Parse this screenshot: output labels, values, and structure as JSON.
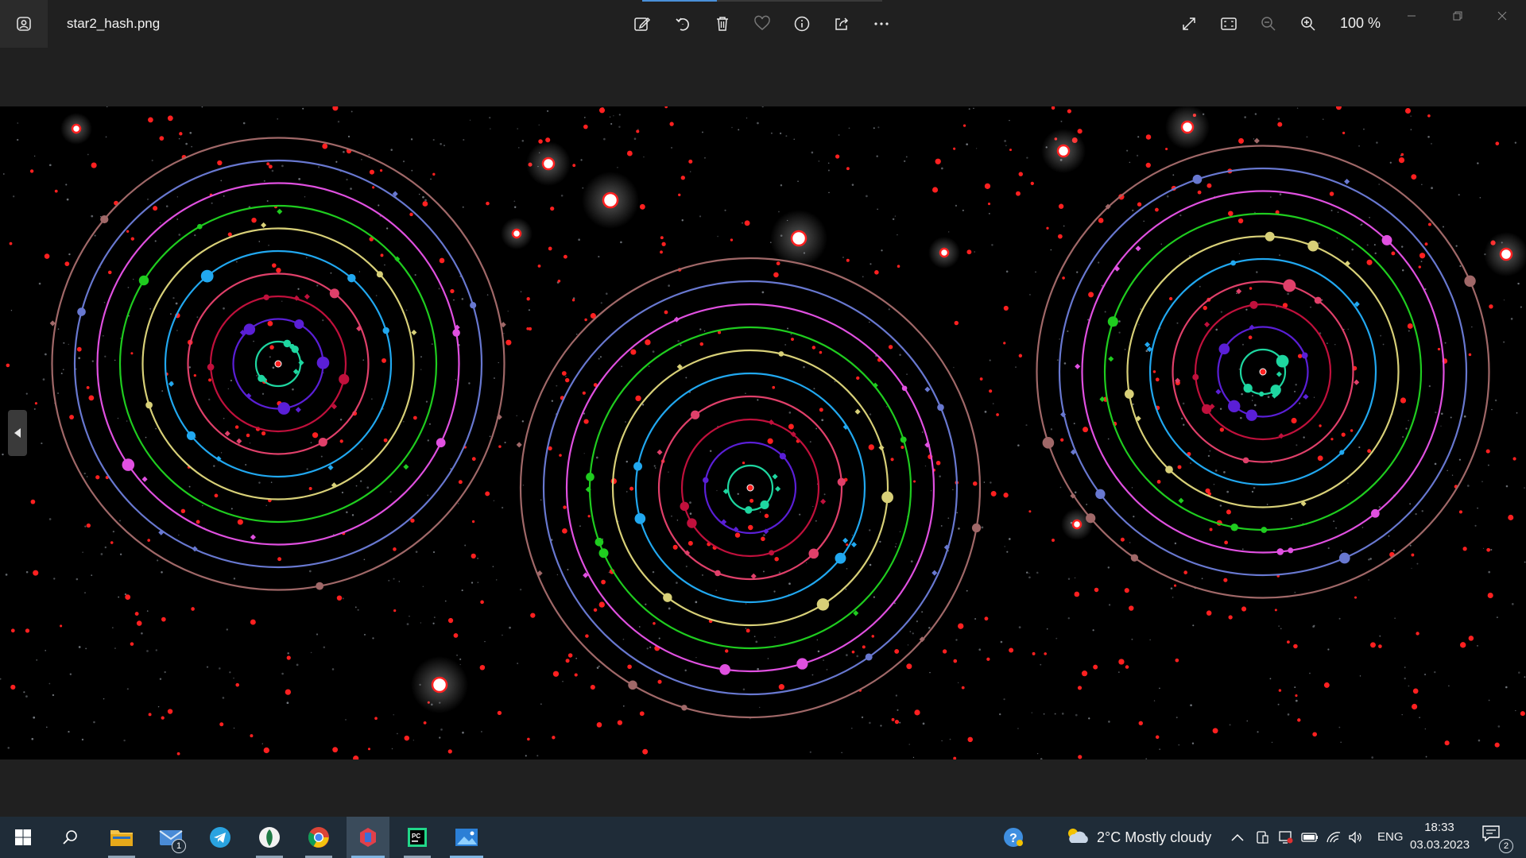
{
  "app": {
    "filename": "star2_hash.png",
    "zoom": "100 %"
  },
  "toolbar": {
    "buttons": [
      "edit-image",
      "rotate",
      "delete",
      "favorite",
      "info",
      "share",
      "more"
    ]
  },
  "viewer": {
    "image_name": "star2_hash.png",
    "background": "#000000",
    "star_color": "#ff2020",
    "systems": [
      {
        "rings": 10
      },
      {
        "rings": 10
      },
      {
        "rings": 10
      }
    ],
    "ring_colors": [
      "#1ed6a0",
      "#5a1fd6",
      "#c0103c",
      "#e0406a",
      "#21a8f0",
      "#d8d078",
      "#1fcc1f",
      "#e050e0",
      "#6878d0",
      "#a06868"
    ]
  },
  "taskbar": {
    "weather": "2°C  Mostly cloudy",
    "language": "ENG",
    "time": "18:33",
    "date": "03.03.2023",
    "mail_badge": "1",
    "notifications_badge": "2"
  }
}
